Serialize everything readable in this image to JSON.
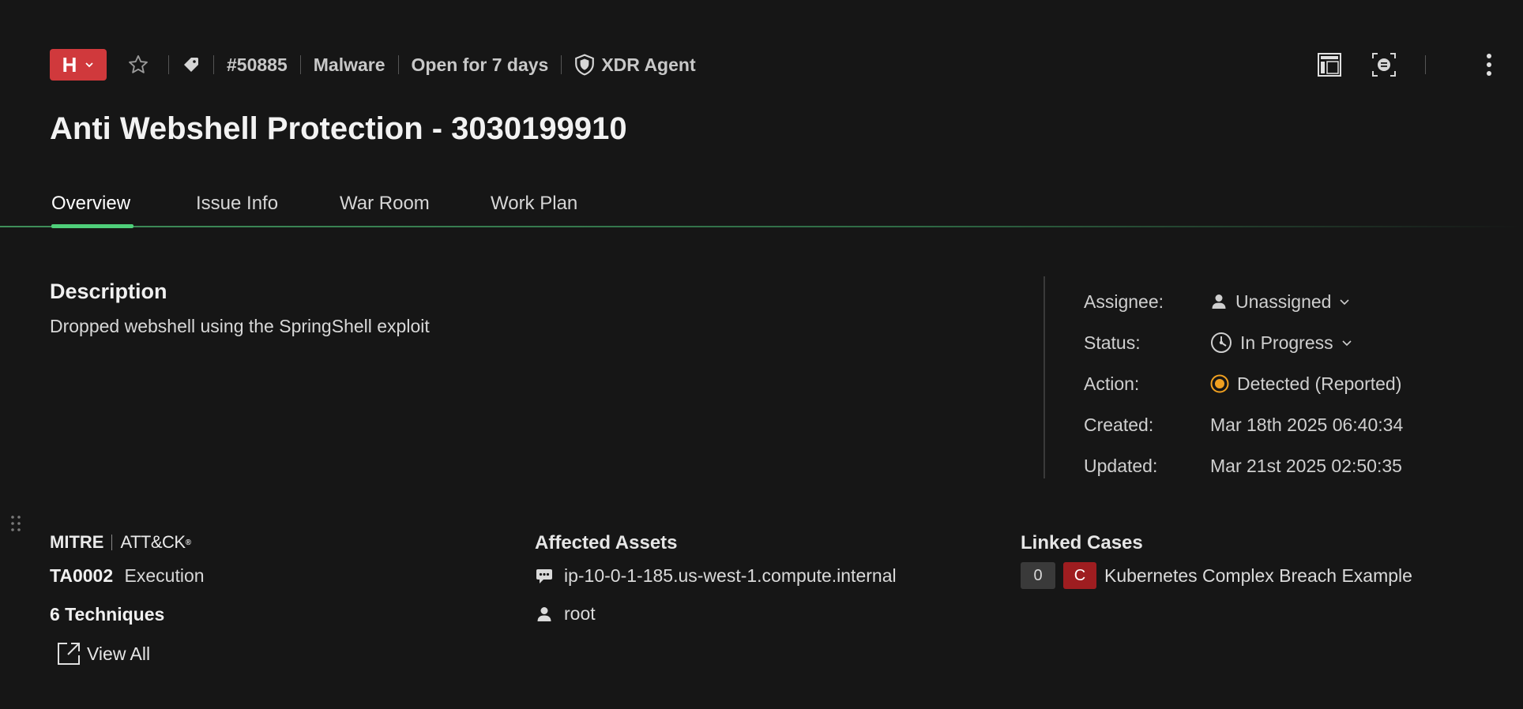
{
  "header": {
    "severity": {
      "letter": "H",
      "color": "#d0393c"
    },
    "issue_id": "#50885",
    "category": "Malware",
    "open_duration": "Open for 7 days",
    "source": "XDR Agent"
  },
  "title": "Anti Webshell Protection - 3030199910",
  "tabs": [
    {
      "label": "Overview",
      "active": true
    },
    {
      "label": "Issue Info",
      "active": false
    },
    {
      "label": "War Room",
      "active": false
    },
    {
      "label": "Work Plan",
      "active": false
    }
  ],
  "description": {
    "heading": "Description",
    "text": "Dropped webshell using the SpringShell exploit"
  },
  "properties": {
    "assignee": {
      "label": "Assignee:",
      "value": "Unassigned"
    },
    "status": {
      "label": "Status:",
      "value": "In Progress"
    },
    "action": {
      "label": "Action:",
      "value": "Detected (Reported)",
      "color": "#f0a020"
    },
    "created": {
      "label": "Created:",
      "value": "Mar 18th 2025 06:40:34"
    },
    "updated": {
      "label": "Updated:",
      "value": "Mar 21st 2025 02:50:35"
    }
  },
  "mitre": {
    "logo_word": "MITRE",
    "logo_suffix": "ATT&CK",
    "tactic_id": "TA0002",
    "tactic_name": "Execution",
    "techniques": "6 Techniques",
    "view_all": "View All"
  },
  "assets": {
    "heading": "Affected Assets",
    "host": "ip-10-0-1-185.us-west-1.compute.internal",
    "user": "root"
  },
  "linked_cases": {
    "heading": "Linked Cases",
    "count": "0",
    "severity_letter": "C",
    "case_name": "Kubernetes Complex Breach Example"
  },
  "colors": {
    "accent": "#4fcf7a",
    "critical": "#9e1d20",
    "background": "#161616"
  }
}
